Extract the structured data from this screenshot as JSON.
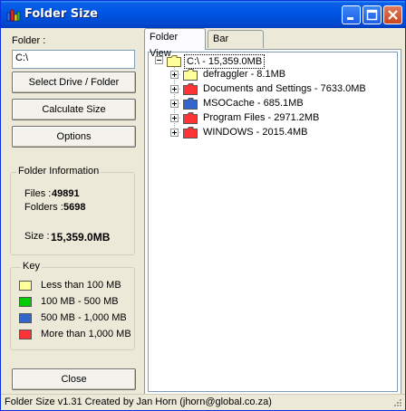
{
  "window": {
    "title": "Folder Size"
  },
  "left": {
    "folder_label": "Folder :",
    "folder_value": "C:\\",
    "select_drive_button": "Select Drive / Folder",
    "calculate_button": "Calculate Size",
    "options_button": "Options",
    "info": {
      "title": "Folder Information",
      "files_label": "Files :",
      "files_value": "49891",
      "folders_label": "Folders :",
      "folders_value": "5698",
      "size_label": "Size :",
      "size_value": "15,359.0MB"
    },
    "key": {
      "title": "Key",
      "items": [
        {
          "label": "Less than 100 MB",
          "color": "#ffff99"
        },
        {
          "label": "100 MB - 500 MB",
          "color": "#00cc00"
        },
        {
          "label": "500 MB - 1,000 MB",
          "color": "#3366cc"
        },
        {
          "label": "More than 1,000 MB",
          "color": "#ff3333"
        }
      ]
    },
    "close_button": "Close"
  },
  "tabs": [
    {
      "label": "Folder View",
      "active": true
    },
    {
      "label": "Bar Graphs",
      "active": false
    }
  ],
  "tree": {
    "root": {
      "label": "C:\\ - 15,359.0MB",
      "color": "#ffff99",
      "expander": "minus"
    },
    "children": [
      {
        "label": "defraggler - 8.1MB",
        "color": "#ffff99"
      },
      {
        "label": "Documents and Settings - 7633.0MB",
        "color": "#ff3333"
      },
      {
        "label": "MSOCache - 685.1MB",
        "color": "#3366cc"
      },
      {
        "label": "Program Files - 2971.2MB",
        "color": "#ff3333"
      },
      {
        "label": "WINDOWS - 2015.4MB",
        "color": "#ff3333"
      }
    ]
  },
  "status": {
    "text": "Folder Size v1.31   Created by Jan Horn   (jhorn@global.co.za)"
  }
}
